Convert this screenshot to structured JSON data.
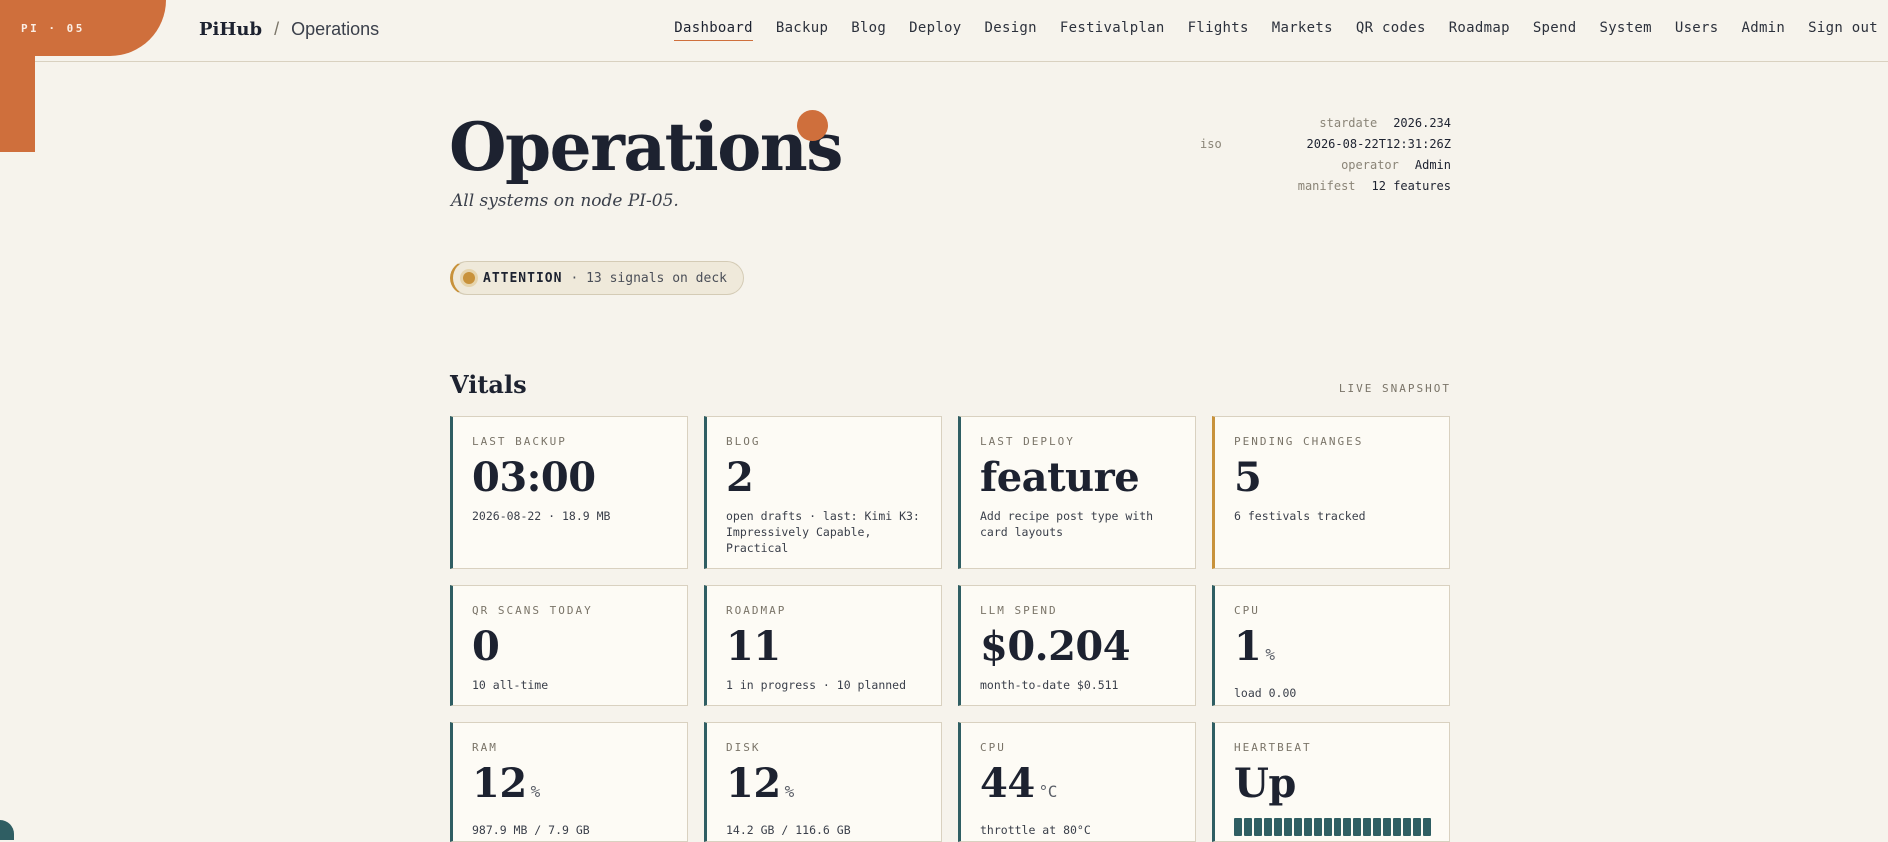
{
  "corner": {
    "label": "PI · 05"
  },
  "brand": {
    "name": "PiHub",
    "separator": "/",
    "page": "Operations"
  },
  "nav": [
    {
      "label": "Dashboard",
      "active": true
    },
    {
      "label": "Backup"
    },
    {
      "label": "Blog"
    },
    {
      "label": "Deploy"
    },
    {
      "label": "Design"
    },
    {
      "label": "Festivalplan"
    },
    {
      "label": "Flights"
    },
    {
      "label": "Markets"
    },
    {
      "label": "QR codes"
    },
    {
      "label": "Roadmap"
    },
    {
      "label": "Spend"
    },
    {
      "label": "System"
    },
    {
      "label": "Users"
    },
    {
      "label": "Admin"
    },
    {
      "label": "Sign out"
    }
  ],
  "hero": {
    "title": "Operations",
    "subtitle": "All systems on node PI-05."
  },
  "meta": {
    "stardate_key": "stardate",
    "stardate_val": "2026.234",
    "iso_key": "iso",
    "iso_val": "2026-08-22T12:31:26Z",
    "operator_key": "operator",
    "operator_val": "Admin",
    "manifest_key": "manifest",
    "manifest_val": "12 features"
  },
  "attention": {
    "label": "ATTENTION",
    "text": "· 13 signals on deck"
  },
  "vitals": {
    "title": "Vitals",
    "tag": "LIVE SNAPSHOT",
    "cards": [
      {
        "label": "LAST BACKUP",
        "value": "03:00",
        "note": "2026-08-22 · 18.9 MB"
      },
      {
        "label": "BLOG",
        "value": "2",
        "note": "open drafts · last: Kimi K3: Impressively Capable, Practical"
      },
      {
        "label": "LAST DEPLOY",
        "value": "feature",
        "note": "Add recipe post type with card layouts"
      },
      {
        "label": "PENDING CHANGES",
        "value": "5",
        "note": "6 festivals tracked"
      },
      {
        "label": "QR SCANS TODAY",
        "value": "0",
        "note": "10 all-time"
      },
      {
        "label": "ROADMAP",
        "value": "11",
        "note": "1 in progress · 10 planned"
      },
      {
        "label": "LLM SPEND",
        "value": "$0.204",
        "note": "month-to-date $0.511"
      },
      {
        "label": "CPU",
        "value": "1",
        "unit": "%",
        "note": "load 0.00"
      },
      {
        "label": "RAM",
        "value": "12",
        "unit": "%",
        "note": "987.9 MB / 7.9 GB"
      },
      {
        "label": "DISK",
        "value": "12",
        "unit": "%",
        "note": "14.2 GB / 116.6 GB"
      },
      {
        "label": "CPU",
        "value": "44",
        "unit": "°C",
        "note": "throttle at 80°C"
      },
      {
        "label": "HEARTBEAT",
        "value": "Up",
        "note": ""
      }
    ]
  },
  "colors": {
    "accent": "#cf6f3c",
    "teal": "#2f5e63",
    "warn": "#c8923b",
    "background": "#f6f3ec"
  }
}
